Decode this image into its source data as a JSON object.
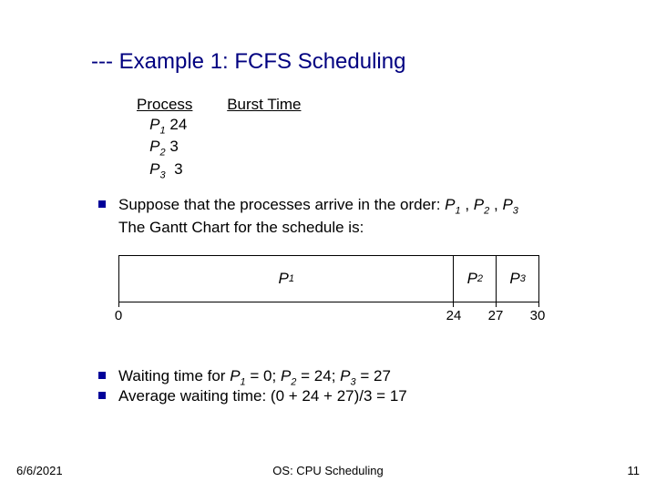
{
  "title": "--- Example 1: FCFS Scheduling",
  "table": {
    "col1": "Process",
    "col2": "Burst Time",
    "rows": [
      {
        "p": "P",
        "sub": "1",
        "bt": "24"
      },
      {
        "p": "P",
        "sub": "2",
        "bt": "3"
      },
      {
        "p": "P",
        "sub": "3",
        "bt": "3"
      }
    ]
  },
  "bullet1a": "Suppose that the processes arrive in the order: ",
  "bullet1b": "The Gantt Chart for the schedule is:",
  "order_sep": " , ",
  "bullet2_pre": "Waiting time for ",
  "bullet2_eq1": "  = 0; ",
  "bullet2_eq2": "  = 24; ",
  "bullet2_eq3": " = 27",
  "bullet3": "Average waiting time:  (0 + 24 + 27)/3 = 17",
  "footer": {
    "date": "6/6/2021",
    "center": "OS: CPU Scheduling",
    "num": "11"
  },
  "chart_data": {
    "type": "bar",
    "title": "Gantt Chart",
    "categories": [
      "P1",
      "P2",
      "P3"
    ],
    "values": [
      24,
      3,
      3
    ],
    "ticks": [
      0,
      24,
      27,
      30
    ],
    "xlabel": "",
    "ylabel": "",
    "ylim": [
      0,
      30
    ]
  }
}
